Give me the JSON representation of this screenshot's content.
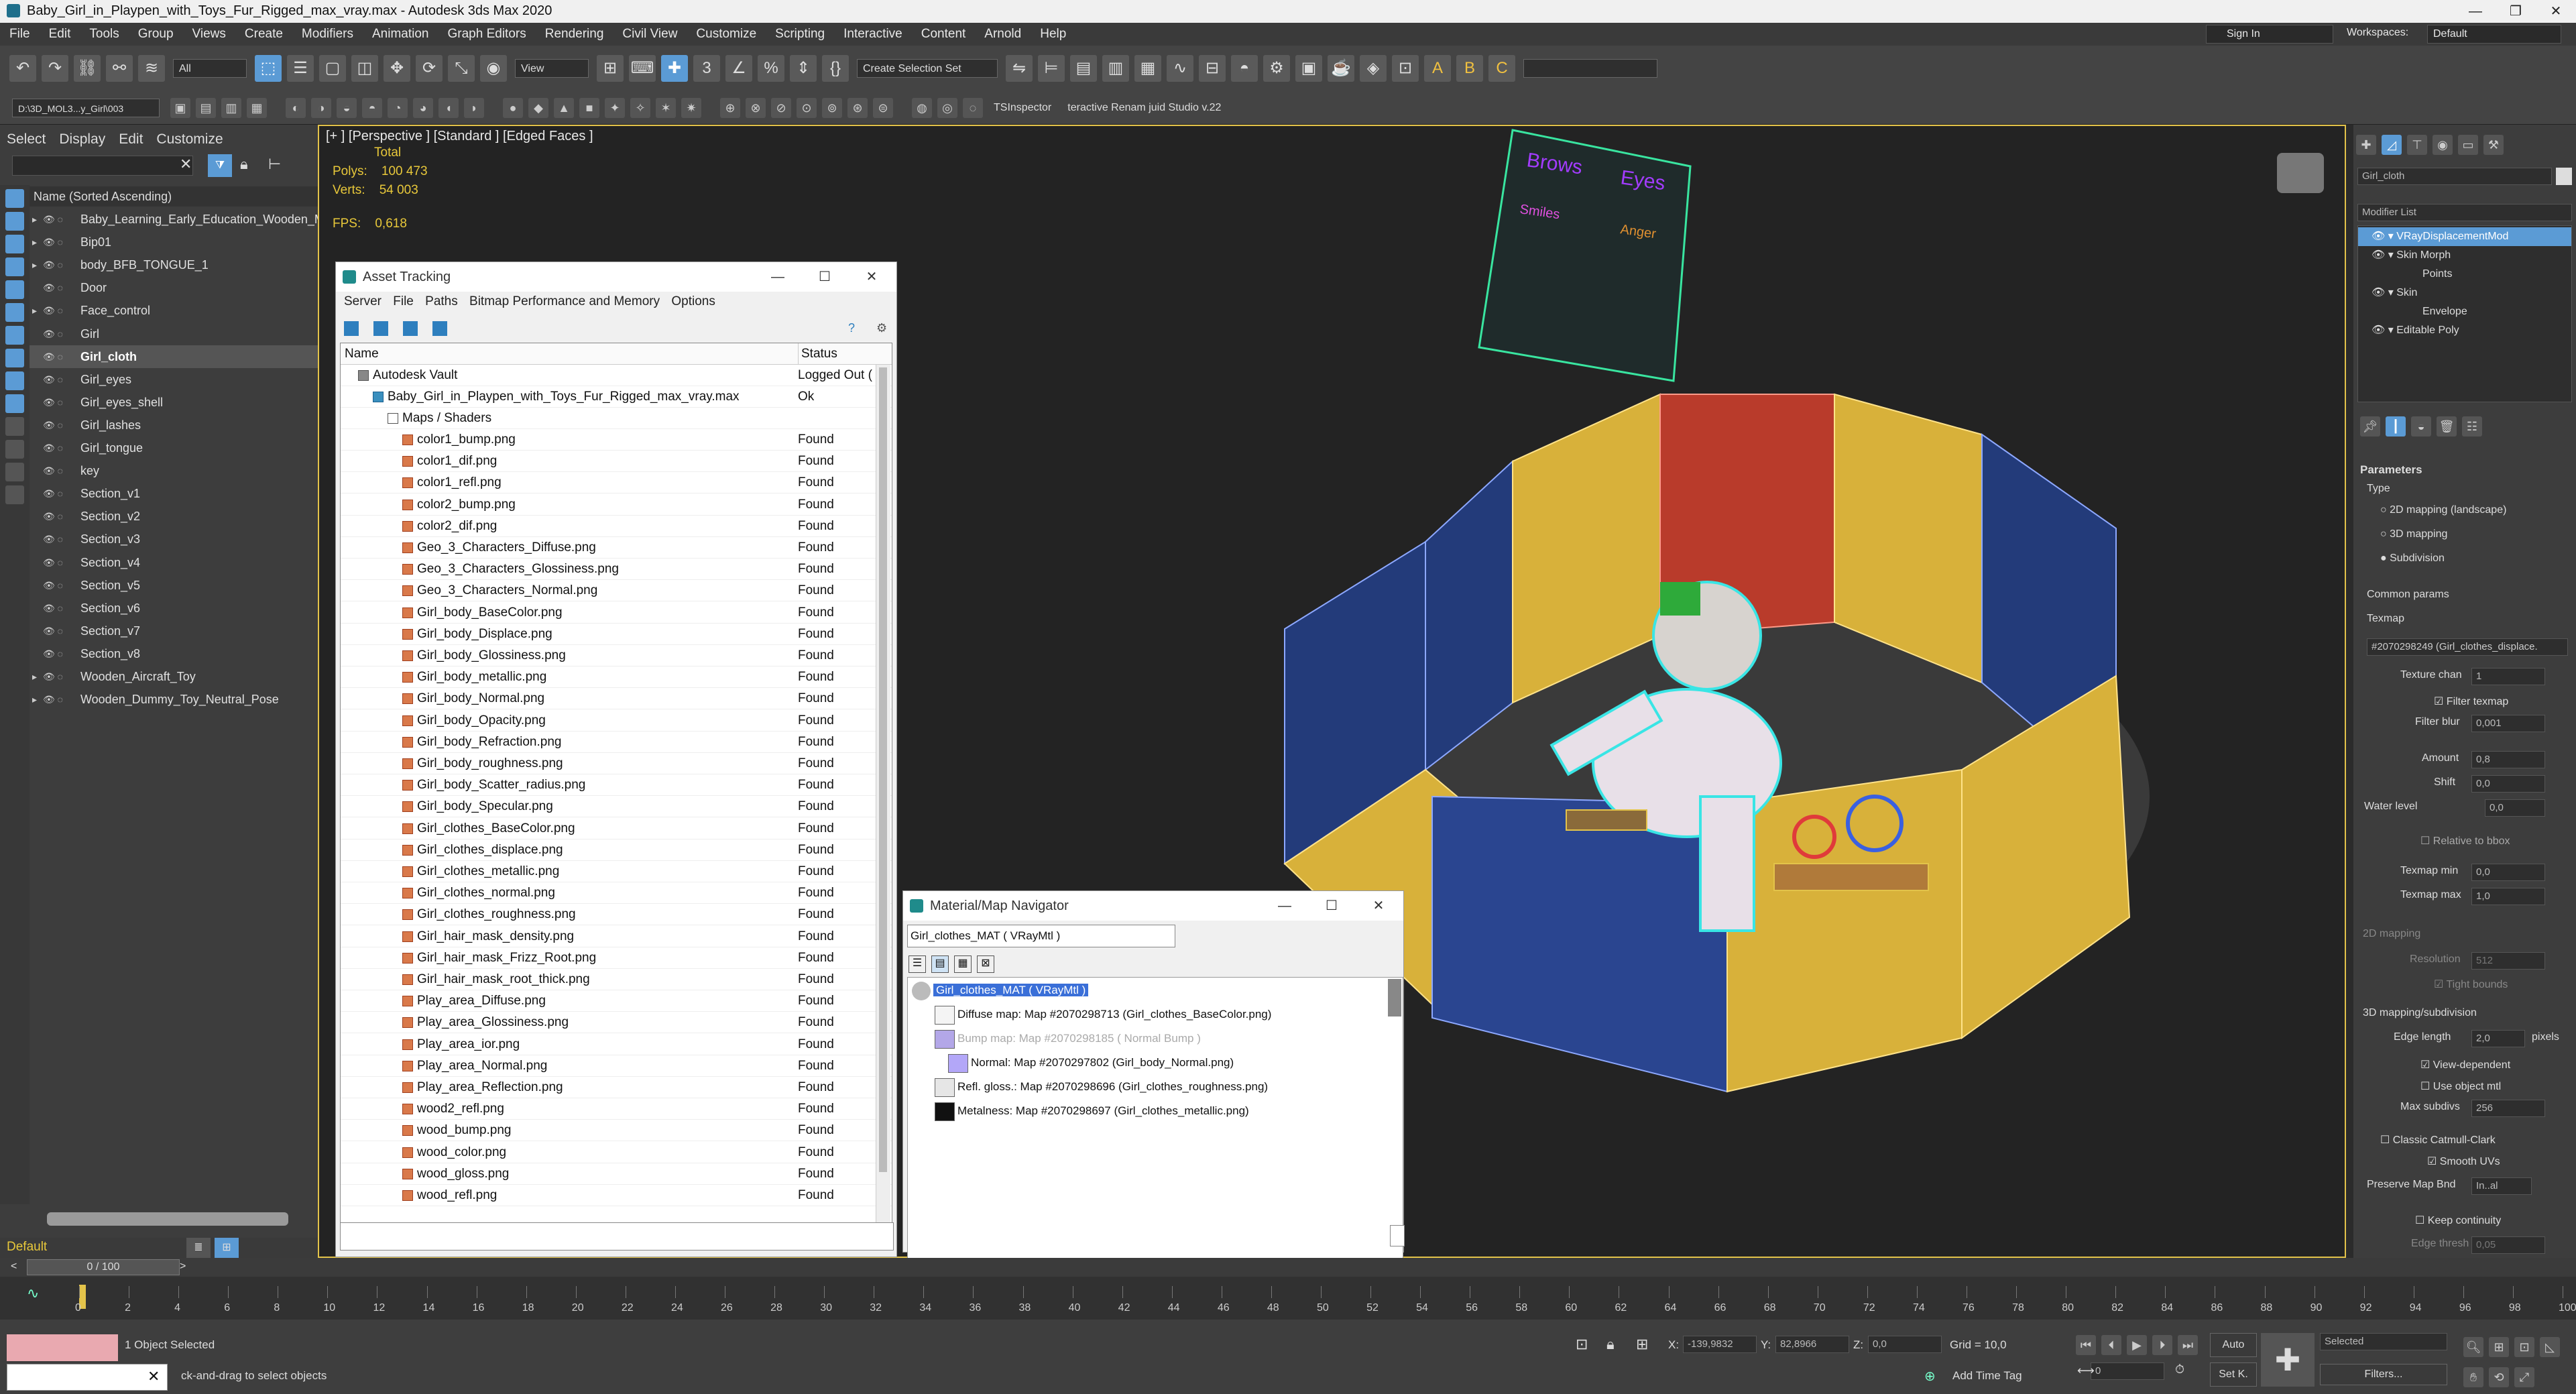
{
  "window": {
    "title": "Baby_Girl_in_Playpen_with_Toys_Fur_Rigged_max_vray.max - Autodesk 3ds Max 2020",
    "minimize": "—",
    "maximize": "❐",
    "close": "✕"
  },
  "menu": [
    "File",
    "Edit",
    "Tools",
    "Group",
    "Views",
    "Create",
    "Modifiers",
    "Animation",
    "Graph Editors",
    "Rendering",
    "Civil View",
    "Customize",
    "Scripting",
    "Interactive",
    "Content",
    "Arnold",
    "Help"
  ],
  "account": {
    "signin": "Sign In",
    "workspaces_label": "Workspaces:",
    "workspace": "Default"
  },
  "toolbar": {
    "filter": "All",
    "view": "View",
    "selection_set": "Create Selection Set",
    "path": "D:\\3D_MOL3...y_Girl\\003",
    "tsinspector": "TSInspector",
    "renamer": "teractive Renam juid Studio v.22"
  },
  "explorer": {
    "tabs": [
      "Select",
      "Display",
      "Edit",
      "Customize"
    ],
    "header": "Name (Sorted Ascending)",
    "items": [
      {
        "name": "Baby_Learning_Early_Education_Wooden_M",
        "expand": true
      },
      {
        "name": "Bip01",
        "expand": true
      },
      {
        "name": "body_BFB_TONGUE_1",
        "expand": true
      },
      {
        "name": "Door",
        "expand": false
      },
      {
        "name": "Face_control",
        "expand": true
      },
      {
        "name": "Girl",
        "expand": false
      },
      {
        "name": "Girl_cloth",
        "expand": false,
        "selected": true
      },
      {
        "name": "Girl_eyes",
        "expand": false
      },
      {
        "name": "Girl_eyes_shell",
        "expand": false
      },
      {
        "name": "Girl_lashes",
        "expand": false
      },
      {
        "name": "Girl_tongue",
        "expand": false
      },
      {
        "name": "key",
        "expand": false
      },
      {
        "name": "Section_v1",
        "expand": false
      },
      {
        "name": "Section_v2",
        "expand": false
      },
      {
        "name": "Section_v3",
        "expand": false
      },
      {
        "name": "Section_v4",
        "expand": false
      },
      {
        "name": "Section_v5",
        "expand": false
      },
      {
        "name": "Section_v6",
        "expand": false
      },
      {
        "name": "Section_v7",
        "expand": false
      },
      {
        "name": "Section_v8",
        "expand": false
      },
      {
        "name": "Wooden_Aircraft_Toy",
        "expand": true
      },
      {
        "name": "Wooden_Dummy_Toy_Neutral_Pose",
        "expand": true
      }
    ],
    "layer": "Default"
  },
  "viewport": {
    "label": "[+ ] [Perspective ] [Standard ] [Edged Faces ]",
    "stats_total": "Total",
    "polys_label": "Polys:",
    "polys": "100 473",
    "verts_label": "Verts:",
    "verts": "54 003",
    "fps_label": "FPS:",
    "fps": "0,618",
    "board_texts": [
      "Brows",
      "Eyes",
      "Smiles",
      "Anger"
    ]
  },
  "asset_tracking": {
    "title": "Asset Tracking",
    "menu": [
      "Server",
      "File",
      "Paths",
      "Bitmap Performance and Memory",
      "Options"
    ],
    "col_name": "Name",
    "col_status": "Status",
    "vault": {
      "name": "Autodesk Vault",
      "status": "Logged Out ("
    },
    "file": {
      "name": "Baby_Girl_in_Playpen_with_Toys_Fur_Rigged_max_vray.max",
      "status": "Ok"
    },
    "folder": "Maps / Shaders",
    "maps": [
      "color1_bump.png",
      "color1_dif.png",
      "color1_refl.png",
      "color2_bump.png",
      "color2_dif.png",
      "Geo_3_Characters_Diffuse.png",
      "Geo_3_Characters_Glossiness.png",
      "Geo_3_Characters_Normal.png",
      "Girl_body_BaseColor.png",
      "Girl_body_Displace.png",
      "Girl_body_Glossiness.png",
      "Girl_body_metallic.png",
      "Girl_body_Normal.png",
      "Girl_body_Opacity.png",
      "Girl_body_Refraction.png",
      "Girl_body_roughness.png",
      "Girl_body_Scatter_radius.png",
      "Girl_body_Specular.png",
      "Girl_clothes_BaseColor.png",
      "Girl_clothes_displace.png",
      "Girl_clothes_metallic.png",
      "Girl_clothes_normal.png",
      "Girl_clothes_roughness.png",
      "Girl_hair_mask_density.png",
      "Girl_hair_mask_Frizz_Root.png",
      "Girl_hair_mask_root_thick.png",
      "Play_area_Diffuse.png",
      "Play_area_Glossiness.png",
      "Play_area_ior.png",
      "Play_area_Normal.png",
      "Play_area_Reflection.png",
      "wood2_refl.png",
      "wood_bump.png",
      "wood_color.png",
      "wood_gloss.png",
      "wood_refl.png"
    ],
    "found": "Found"
  },
  "material_nav": {
    "title": "Material/Map Navigator",
    "field": "Girl_clothes_MAT  ( VRayMtl )",
    "root": "Girl_clothes_MAT  ( VRayMtl )",
    "rows": [
      "Diffuse map: Map #2070298713 (Girl_clothes_BaseColor.png)",
      "Bump map: Map #2070298185  ( Normal Bump )",
      "Normal: Map #2070297802 (Girl_body_Normal.png)",
      "Refl. gloss.: Map #2070298696 (Girl_clothes_roughness.png)",
      "Metalness: Map #2070298697 (Girl_clothes_metallic.png)"
    ]
  },
  "command_panel": {
    "object_name": "Girl_cloth",
    "modifier_list": "Modifier List",
    "stack": [
      {
        "name": "VRayDisplacementMod",
        "level": 0,
        "selected": true
      },
      {
        "name": "Skin Morph",
        "level": 0
      },
      {
        "name": "Points",
        "level": 1
      },
      {
        "name": "Skin",
        "level": 0
      },
      {
        "name": "Envelope",
        "level": 1
      },
      {
        "name": "Editable Poly",
        "level": 0
      }
    ],
    "parameters": "Parameters",
    "type": "Type",
    "type_opts": [
      "2D mapping (landscape)",
      "3D mapping",
      "Subdivision"
    ],
    "common": "Common params",
    "texmap": "Texmap",
    "texmap_val": "#2070298249 (Girl_clothes_displace.",
    "texture_chan_label": "Texture chan",
    "texture_chan": "1",
    "filter_texmap": "Filter texmap",
    "filter_blur_label": "Filter blur",
    "filter_blur": "0,001",
    "amount_label": "Amount",
    "amount": "0,8",
    "shift_label": "Shift",
    "shift": "0,0",
    "water_label": "Water level",
    "water": "0,0",
    "relative": "Relative to bbox",
    "texmap_min_label": "Texmap min",
    "texmap_min": "0,0",
    "texmap_max_label": "Texmap max",
    "texmap_max": "1,0",
    "sec_2d": "2D mapping",
    "resolution_label": "Resolution",
    "resolution": "512",
    "tight": "Tight bounds",
    "sec_3d": "3D mapping/subdivision",
    "edge_label": "Edge length",
    "edge": "2,0",
    "pixels": "pixels",
    "view_dep": "View-dependent",
    "use_obj": "Use object mtl",
    "max_sub_label": "Max subdivs",
    "max_sub": "256",
    "catmull": "Classic Catmull-Clark",
    "smooth_uv": "Smooth UVs",
    "preserve_label": "Preserve Map Bnd",
    "preserve": "In..al",
    "keep": "Keep continuity",
    "edge_thresh_label": "Edge thresh",
    "edge_thresh": "0,05"
  },
  "timeline": {
    "frame": "0 / 100",
    "ticks": [
      "0",
      "2",
      "4",
      "6",
      "8",
      "10",
      "12",
      "14",
      "16",
      "18",
      "20",
      "22",
      "24",
      "26",
      "28",
      "30",
      "32",
      "34",
      "36",
      "38",
      "40",
      "42",
      "44",
      "46",
      "48",
      "50",
      "52",
      "54",
      "56",
      "58",
      "60",
      "62",
      "64",
      "66",
      "68",
      "70",
      "72",
      "74",
      "76",
      "78",
      "80",
      "82",
      "84",
      "86",
      "88",
      "90",
      "92",
      "94",
      "96",
      "98",
      "100"
    ]
  },
  "status": {
    "selected": "1 Object Selected",
    "hint": "ck-and-drag to select objects",
    "x_label": "X:",
    "x": "-139,9832",
    "y_label": "Y:",
    "y": "82,8966",
    "z_label": "Z:",
    "z": "0,0",
    "grid": "Grid = 10,0",
    "add_time_tag": "Add Time Tag",
    "auto": "Auto",
    "set_key": "Set K.",
    "selected_dd": "Selected",
    "filters": "Filters...",
    "frame_field": "0"
  }
}
